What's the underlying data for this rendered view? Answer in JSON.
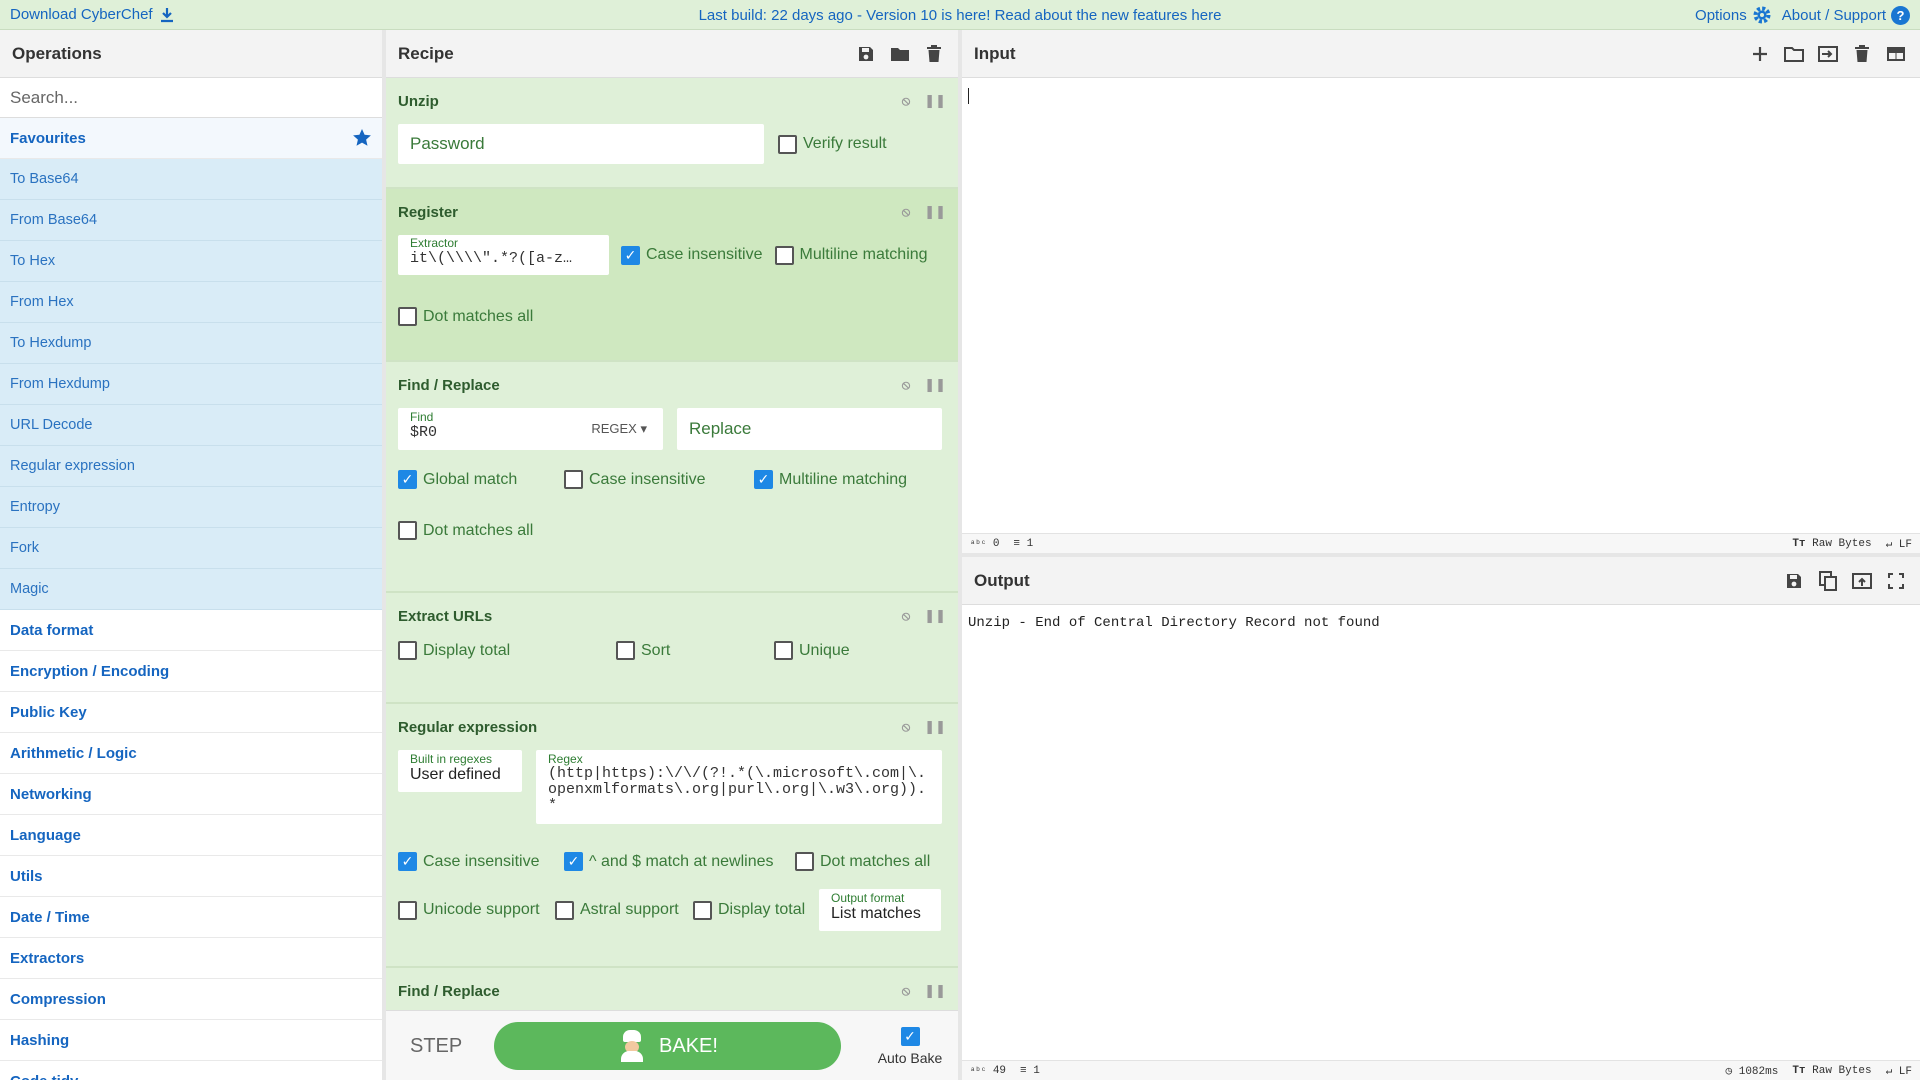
{
  "banner": {
    "download": "Download CyberChef",
    "message": "Last build: 22 days ago - Version 10 is here! Read about the new features here",
    "options": "Options",
    "about": "About / Support"
  },
  "operations": {
    "title": "Operations",
    "search_placeholder": "Search...",
    "favourites": "Favourites",
    "fav_items": [
      "To Base64",
      "From Base64",
      "To Hex",
      "From Hex",
      "To Hexdump",
      "From Hexdump",
      "URL Decode",
      "Regular expression",
      "Entropy",
      "Fork",
      "Magic"
    ],
    "categories": [
      "Data format",
      "Encryption / Encoding",
      "Public Key",
      "Arithmetic / Logic",
      "Networking",
      "Language",
      "Utils",
      "Date / Time",
      "Extractors",
      "Compression",
      "Hashing",
      "Code tidy"
    ]
  },
  "recipe": {
    "title": "Recipe",
    "unzip": {
      "title": "Unzip",
      "password_placeholder": "Password",
      "verify": "Verify result"
    },
    "register": {
      "title": "Register",
      "extractor_label": "Extractor",
      "extractor_value": "it\\(\\\\\\\\\".*?([a-z…",
      "case": "Case insensitive",
      "multiline": "Multiline matching",
      "dotall": "Dot matches all"
    },
    "find1": {
      "title": "Find / Replace",
      "find_label": "Find",
      "find_value": "$R0",
      "mode": "REGEX",
      "replace_placeholder": "Replace",
      "global": "Global match",
      "case": "Case insensitive",
      "multiline": "Multiline matching",
      "dotall": "Dot matches all"
    },
    "urls": {
      "title": "Extract URLs",
      "display_total": "Display total",
      "sort": "Sort",
      "unique": "Unique"
    },
    "regex": {
      "title": "Regular expression",
      "builtin_label": "Built in regexes",
      "builtin_value": "User defined",
      "regex_label": "Regex",
      "regex_value": "(http|https):\\/\\/(?!.*(\\.microsoft\\.com|\\.openxmlformats\\.org|purl\\.org|\\.w3\\.org)).*",
      "case": "Case insensitive",
      "newlines": "^ and $ match at newlines",
      "dotall": "Dot matches all",
      "unicode": "Unicode support",
      "astral": "Astral support",
      "display_total": "Display total",
      "format_label": "Output format",
      "format_value": "List matches"
    },
    "find2": {
      "title": "Find / Replace"
    },
    "step": "STEP",
    "bake": "BAKE!",
    "autobake": "Auto Bake"
  },
  "input": {
    "title": "Input",
    "chars": "0",
    "lines": "1",
    "encoding": "Raw Bytes",
    "eol": "LF"
  },
  "output": {
    "title": "Output",
    "text": "Unzip - End of Central Directory Record not found",
    "chars": "49",
    "lines": "1",
    "time": "1082ms",
    "encoding": "Raw Bytes",
    "eol": "LF"
  }
}
